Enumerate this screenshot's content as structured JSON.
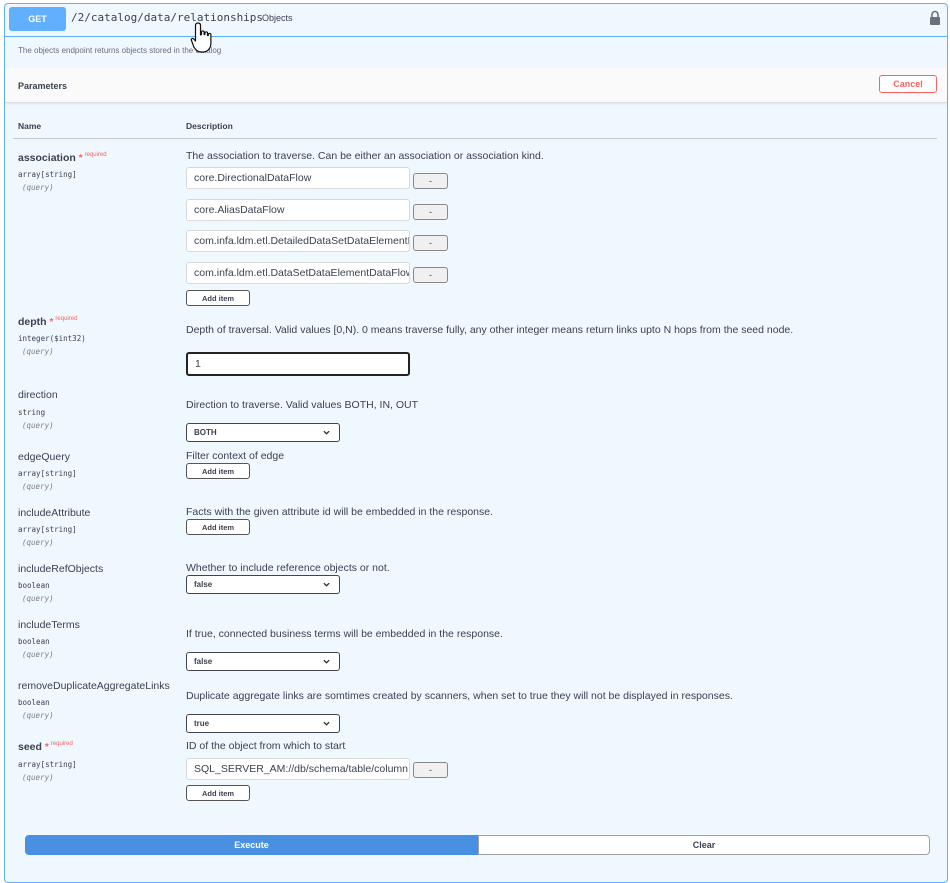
{
  "endpoint": {
    "method": "GET",
    "path": "/2/catalog/data/relationships",
    "summary": "Objects",
    "description": "The objects endpoint returns objects stored in the catalog"
  },
  "section": {
    "title": "Parameters",
    "cancel_label": "Cancel"
  },
  "columns": {
    "name": "Name",
    "description": "Description"
  },
  "required_label": "required",
  "required_star": "*",
  "params": {
    "association": {
      "name": "association",
      "type": "array[string]",
      "in": "(query)",
      "description": "The association to traverse. Can be either an association or association kind.",
      "items": [
        "core.DirectionalDataFlow",
        "core.AliasDataFlow",
        "com.infa.ldm.etl.DetailedDataSetDataElementDataFlow",
        "com.infa.ldm.etl.DataSetDataElementDataFlow"
      ],
      "add_label": "Add item",
      "remove_label": "-"
    },
    "depth": {
      "name": "depth",
      "type": "integer($int32)",
      "in": "(query)",
      "description": "Depth of traversal. Valid values [0,N). 0 means traverse fully, any other integer means return links upto N hops from the seed node.",
      "value": "1"
    },
    "direction": {
      "name": "direction",
      "type": "string",
      "in": "(query)",
      "description": "Direction to traverse. Valid values BOTH, IN, OUT",
      "value": "BOTH"
    },
    "edgeQuery": {
      "name": "edgeQuery",
      "type": "array[string]",
      "in": "(query)",
      "description": "Filter context of edge",
      "add_label": "Add item"
    },
    "includeAttribute": {
      "name": "includeAttribute",
      "type": "array[string]",
      "in": "(query)",
      "description": "Facts with the given attribute id will be embedded in the response.",
      "add_label": "Add item"
    },
    "includeRefObjects": {
      "name": "includeRefObjects",
      "type": "boolean",
      "in": "(query)",
      "description": "Whether to include reference objects or not.",
      "value": "false"
    },
    "includeTerms": {
      "name": "includeTerms",
      "type": "boolean",
      "in": "(query)",
      "description": "If true, connected business terms will be embedded in the response.",
      "value": "false"
    },
    "removeDuplicateAggregateLinks": {
      "name": "removeDuplicateAggregateLinks",
      "type": "boolean",
      "in": "(query)",
      "description": "Duplicate aggregate links are somtimes created by scanners, when set to true they will not be displayed in responses.",
      "value": "true"
    },
    "seed": {
      "name": "seed",
      "type": "array[string]",
      "in": "(query)",
      "description": "ID of the object from which to start",
      "items": [
        "SQL_SERVER_AM://db/schema/table/column"
      ],
      "add_label": "Add item",
      "remove_label": "-"
    }
  },
  "actions": {
    "execute_label": "Execute",
    "clear_label": "Clear"
  },
  "colors": {
    "get": "#61affe",
    "execute": "#4990e2",
    "required": "#ff6060"
  },
  "icons": [
    "lock-icon",
    "chevron-down-icon",
    "hand-cursor-icon"
  ]
}
